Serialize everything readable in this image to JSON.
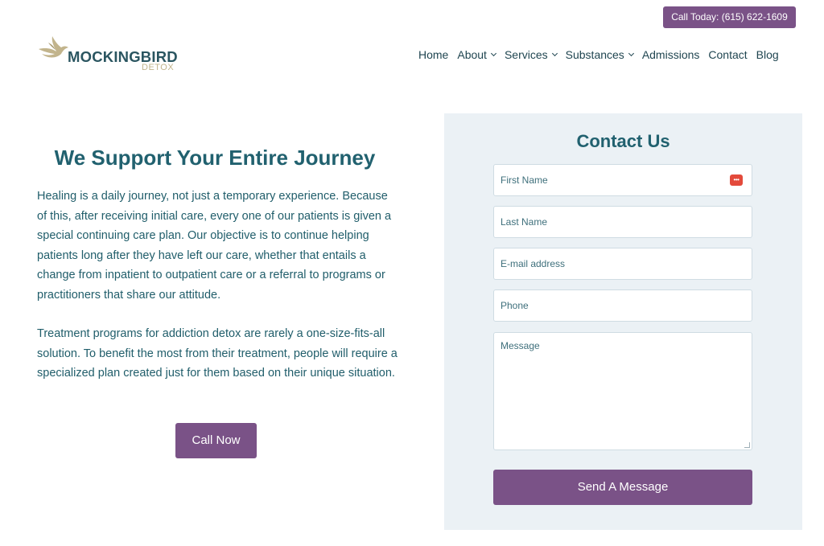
{
  "header": {
    "call_today": "Call Today: (615) 622-1609",
    "logo_main": "MOCKINGBIRD",
    "logo_sub": "DETOX",
    "brand_colors": {
      "teal": "#21616f",
      "gold": "#c2b48c",
      "purple": "#7a5287"
    }
  },
  "nav": {
    "items": [
      {
        "label": "Home",
        "dropdown": false
      },
      {
        "label": "About",
        "dropdown": true
      },
      {
        "label": "Services",
        "dropdown": true
      },
      {
        "label": "Substances",
        "dropdown": true
      },
      {
        "label": "Admissions",
        "dropdown": false
      },
      {
        "label": "Contact",
        "dropdown": false
      },
      {
        "label": "Blog",
        "dropdown": false
      }
    ]
  },
  "main": {
    "heading": "We Support Your Entire Journey",
    "paragraph_1": "Healing is a daily journey, not just a temporary experience. Because of this, after receiving initial care, every one of our patients is given a special continuing care plan. Our objective is to continue helping patients long after they have left our care, whether that entails a change from inpatient to outpatient care or a referral to programs or practitioners that share our attitude.",
    "paragraph_2": "Treatment programs for addiction detox are rarely a one-size-fits-all solution. To benefit the most from their treatment, people will require a specialized plan created just for them based on their unique situation.",
    "call_now": "Call Now"
  },
  "contact": {
    "title": "Contact Us",
    "fields": {
      "first_name": "First Name",
      "last_name": "Last Name",
      "email": "E-mail address",
      "phone": "Phone",
      "message": "Message"
    },
    "autofill_icon": "password-manager-icon",
    "submit": "Send A Message"
  }
}
